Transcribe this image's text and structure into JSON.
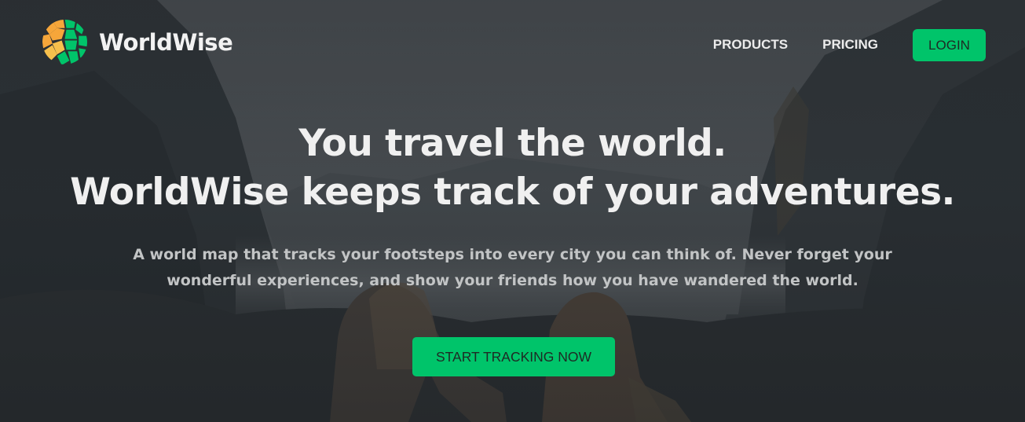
{
  "brand": {
    "name": "WorldWise",
    "logo_icon": "globe-hexagon-logo-icon",
    "accent_color": "#00c46a"
  },
  "nav": {
    "items": [
      {
        "label": "PRODUCTS"
      },
      {
        "label": "PRICING"
      }
    ],
    "login_label": "LOGIN"
  },
  "hero": {
    "title_line1": "You travel the world.",
    "title_line2": "WorldWise keeps track of your adventures.",
    "subtitle": "A world map that tracks your footsteps into every city you can think of. Never forget your wonderful experiences, and show your friends how you have wandered the world.",
    "cta_label": "START TRACKING NOW",
    "background": "mountain-valley-travelers-photo"
  }
}
